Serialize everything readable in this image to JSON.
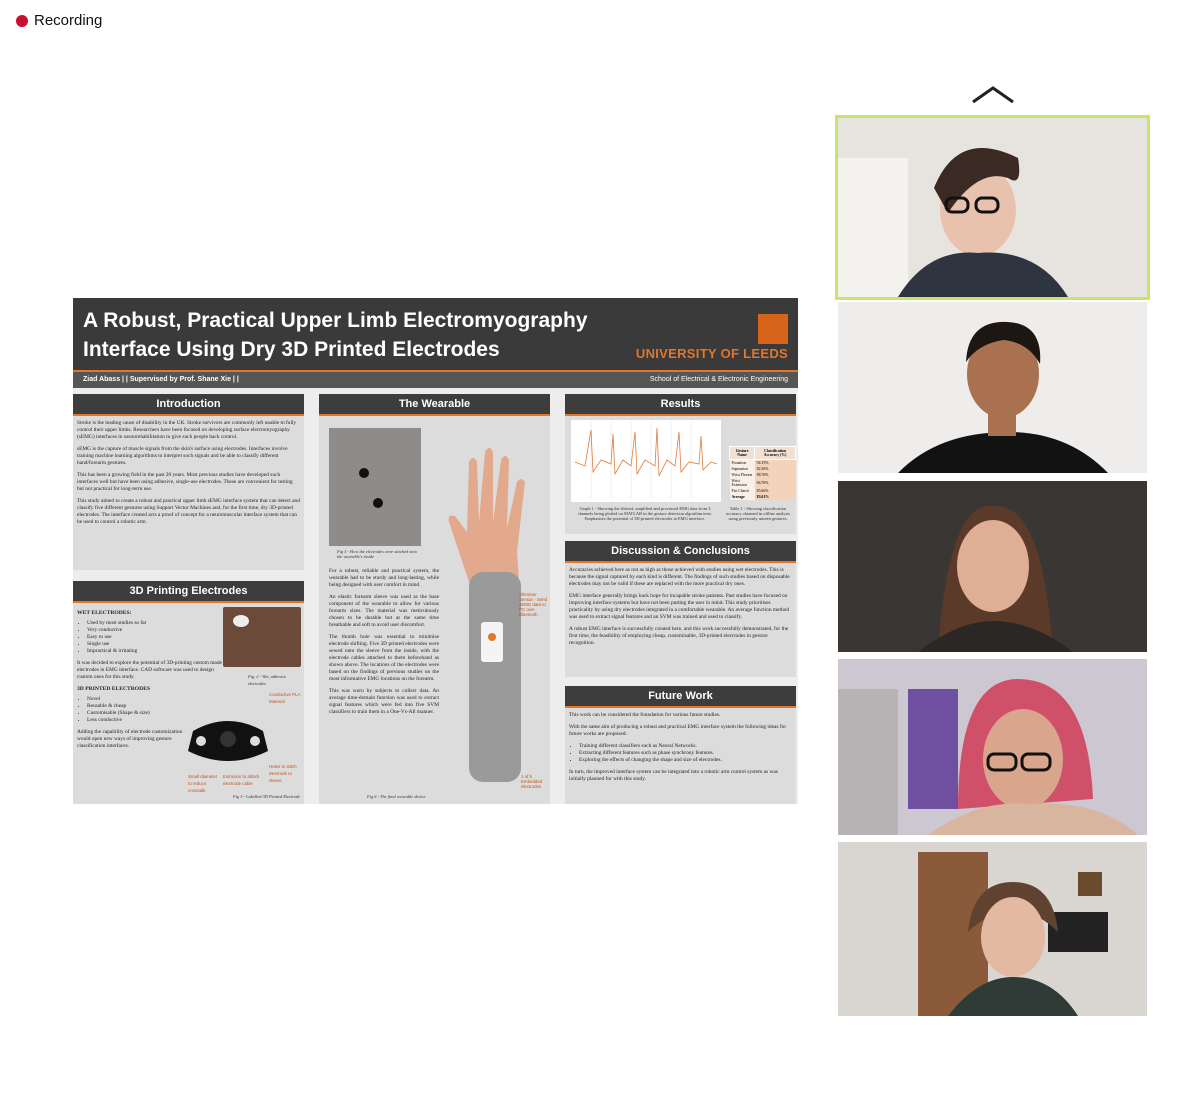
{
  "recording": {
    "label": "Recording"
  },
  "poster": {
    "title": "A Robust, Practical Upper Limb Electromyography Interface Using Dry 3D Printed Electrodes",
    "university": "UNIVERSITY OF LEEDS",
    "authors": "Ziad Abass | | Supervised by Prof. Shane Xie | |",
    "school": "School of Electrical & Electronic Engineering",
    "intro": {
      "heading": "Introduction",
      "p1": "Stroke is the leading cause of disability in the UK. Stroke survivors are commonly left unable to fully control their upper limbs. Researchers have been focused on developing surface electromyography (sEMG) interfaces in neurorehabilitation to give such people back control.",
      "p2": "sEMG is the capture of muscle signals from the skin's surface using electrodes. Interfaces involve training machine learning algorithms to interpret such signals and be able to classify different hand/forearm gestures.",
      "p3": "This has been a growing field in the past 20 years. Most previous studies have developed such interfaces well but have been using adhesive, single-use electrodes. These are convenient for testing but not practical for long-term use.",
      "p4": "This study aimed to create a robust and practical upper limb sEMG interface system that can detect and classify five different gestures using Support Vector Machines and, for the first time, dry 3D-printed electrodes. The interface created acts a proof of concept for a neuromuscular interface system that can be used to control a robotic arm."
    },
    "printing": {
      "heading": "3D Printing Electrodes",
      "wet_label": "WET ELECTRODES:",
      "wet_items": [
        "Used by most studies so far",
        "Very conductive",
        "Easy to use",
        "Single use",
        "Impractical & irritating"
      ],
      "p1": "It was decided to explore the potential of 3D-printing custom made electrodes in EMG interface. CAD software was used to design custom ones for this study.",
      "fig2": "Fig. 2 - Wet, adhesive electrodes",
      "printed_label": "3D PRINTED ELECTRODES",
      "printed_items": [
        "Novel",
        "Reusable & cheap",
        "Customisable (Shape & size)",
        "Less conductive"
      ],
      "p2": "Adding the capability of electrode customization would open new ways of improving gesture classification interfaces.",
      "ann_pla": "Conductive PLA Material",
      "ann_small": "Small diameter to reduce crosstalk",
      "ann_extrusion": "Extrusion to attach electrode cable",
      "ann_holes": "Holes to stitch electrode to sleeve",
      "fig3": "Fig 3 - Labelled 3D Printed Electrode"
    },
    "wearable": {
      "heading": "The Wearable",
      "fig4": "Fig 5 - How the electrodes were stitched onto the wearable's inside",
      "p1": "For a robust, reliable and practical system, the wearable had to be sturdy and long-lasting, while being designed with user comfort in mind.",
      "p2": "An elastic forearm sleeve was used as the base component of the wearable to allow for various forearm sizes. The material was meticulously chosen to be durable but at the same time breathable and soft to avoid user discomfort.",
      "p3": "The thumb hole was essential to minimise electrode shifting. Five 3D printed electrodes were sewed onto the sleeve from the inside, with the electrode cables attached to them beforehand as shown above. The locations of the electrodes were based on the findings of previous studies on the most informative EMG locations on the forearm.",
      "p4": "This was worn by subjects to collect data. An average time-domain function was used to extract signal features which were fed into five SVM classifiers to train them in a One-Vs-All manner.",
      "ann_shimmer": "Shimmer Sensor - Send sEMG data to PC over Bluetooth",
      "ann_five": "1 of 5 Embedded electrodes",
      "fig6": "Fig 6 - The final wearable device"
    },
    "results": {
      "heading": "Results",
      "graph_caption": "Graph 1 - Showing the filtered, amplified and processed EMG data from 3 channels being plotted on MATLAB in the gesture detection algorithm tests. Emphasises the potential of 3D-printed electrodes in EMG interface.",
      "table_caption": "Table 1 - Showing classification accuracy obtained in offline analysis using previously unseen gestures.",
      "table_headers": [
        "Gesture Name",
        "Classification Accuracy (%)"
      ],
      "table_rows": [
        [
          "Pronation",
          "94.15%"
        ],
        [
          "Supination",
          "82.36%"
        ],
        [
          "Wrist Flexion",
          "88.76%"
        ],
        [
          "Wrist Extension",
          "66.76%"
        ],
        [
          "Fist Clench",
          "85.66%"
        ],
        [
          "Average",
          "83.61%"
        ]
      ]
    },
    "discussion": {
      "heading": "Discussion & Conclusions",
      "p1": "Accuracies achieved here as not as high as those achieved with studies using wet electrodes. This is because the signal captured by each kind is different. The findings of such studies based on disposable electrodes may not be valid if these are replaced with the more practical dry ones.",
      "p2": "EMG interface generally brings back hope for incapable stroke patients. Past studies have focused on improving interface systems but have not been putting the user in mind. This study prioritises practicality by using dry electrodes integrated in a comfortable wearable. An average function method was used to extract signal features and an SVM was trained and used to classify.",
      "p3": "A robust EMG interface is successfully created here, and this work successfully demonstrated, for the first time, the feasibility of employing cheap, customisable, 3D-printed electrodes in gesture recognition."
    },
    "future": {
      "heading": "Future Work",
      "p1": "This work can be considered the foundation for various future studies.",
      "p2": "With the same aim of producing a robust and practical EMG interface system the following ideas for future works are proposed:",
      "items": [
        "Training different classifiers such as Neural Networks.",
        "Extracting different features such as phase synchrony features.",
        "Exploring the effects of changing the shape and size of electrodes."
      ],
      "p3": "In turn, the improved interface system can be integrated into a robotic arm control system as was initially planned for with this study."
    }
  },
  "participants": [
    {
      "name": "participant-1",
      "bg": "#e7e4e0",
      "skin": "#e9c2ae",
      "hair": "#3b2a24",
      "shirt": "#2e3440"
    },
    {
      "name": "participant-2",
      "bg": "#efedeb",
      "skin": "#a9714f",
      "hair": "#1d1714",
      "shirt": "#121212"
    },
    {
      "name": "participant-3",
      "bg": "#3a3634",
      "skin": "#dfae94",
      "hair": "#5b3a2a",
      "shirt": "#2b2725"
    },
    {
      "name": "participant-4",
      "bg": "#cdc7d2",
      "skin": "#d9a58c",
      "hair": "#d0506a",
      "shirt": "#d8b59f"
    },
    {
      "name": "participant-5",
      "bg": "#d9d6d1",
      "skin": "#e4b9a2",
      "hair": "#5f4330",
      "shirt": "#2f3b36"
    }
  ]
}
